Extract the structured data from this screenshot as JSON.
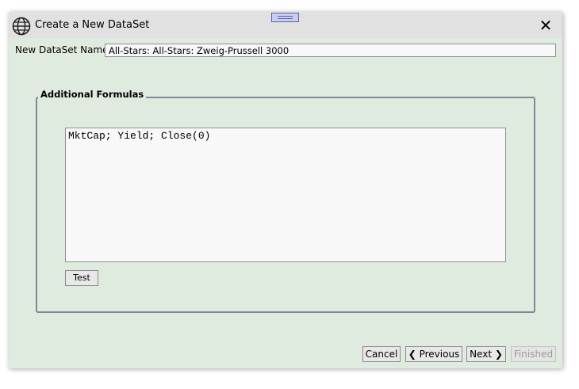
{
  "window": {
    "title": "Create a New DataSet",
    "close_glyph": "✕",
    "icon": "globe-icon"
  },
  "dataset_name": {
    "label": "New DataSet Name:",
    "value": "All-Stars: All-Stars: Zweig-Prussell 3000"
  },
  "formulas": {
    "group_title": "Additional Formulas",
    "text": "MktCap; Yield; Close(0)",
    "test_label": "Test"
  },
  "footer": {
    "cancel_label": "Cancel",
    "previous_label": "❮ Previous",
    "next_label": "Next ❯",
    "finished_label": "Finished"
  }
}
